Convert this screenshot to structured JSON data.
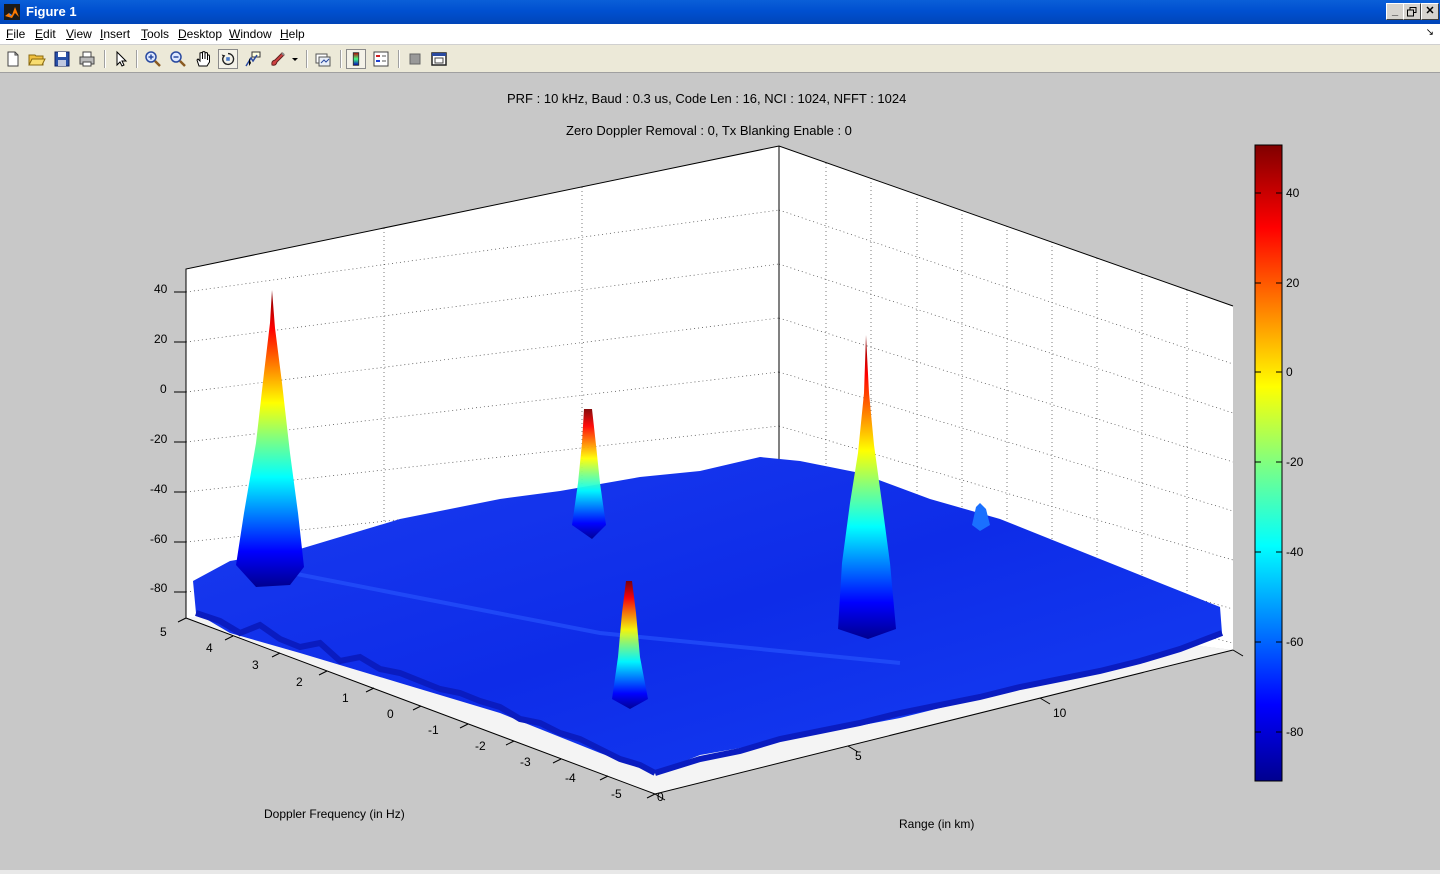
{
  "window": {
    "title": "Figure 1",
    "controls": [
      "minimize-icon",
      "restore-icon",
      "close-icon"
    ]
  },
  "menu": {
    "items": [
      "File",
      "Edit",
      "View",
      "Insert",
      "Tools",
      "Desktop",
      "Window",
      "Help"
    ],
    "underline_first_letter": true
  },
  "toolbar": {
    "buttons": [
      "new-figure-icon",
      "open-file-icon",
      "save-icon",
      "print-icon",
      "edit-plot-arrow-icon",
      "zoom-in-icon",
      "zoom-out-icon",
      "pan-hand-icon",
      "rotate-3d-icon",
      "data-cursor-icon",
      "brush-icon",
      "brush-dropdown-icon",
      "link-plot-icon",
      "insert-colorbar-icon",
      "insert-legend-icon",
      "hide-plot-tools-icon",
      "show-plot-tools-icon"
    ]
  },
  "plot": {
    "title_line1": "PRF : 10 kHz, Baud : 0.3 us, Code Len : 16, NCI : 1024, NFFT : 1024",
    "title_line2": "Zero Doppler Removal : 0, Tx Blanking Enable : 0",
    "xlabel": "Doppler Frequency (in Hz)",
    "ylabel": "Range (in km)",
    "colorbar_ticks": [
      "40",
      "20",
      "0",
      "-20",
      "-40",
      "-60",
      "-80"
    ],
    "colors": {
      "axis_bg": "#ffffff",
      "figure_bg": "#c8c8c8",
      "noise_floor": "#1030f0"
    }
  },
  "chart_data": {
    "type": "surface",
    "colormap": "jet",
    "x_axis": {
      "label": "Doppler Frequency (in Hz)",
      "range": [
        -5,
        5
      ],
      "ticks": [
        5,
        4,
        3,
        2,
        1,
        0,
        -1,
        -2,
        -3,
        -4,
        -5
      ]
    },
    "y_axis": {
      "label": "Range (in km)",
      "range": [
        0,
        15
      ],
      "ticks": [
        0,
        5,
        10
      ]
    },
    "z_axis": {
      "range": [
        -90,
        50
      ],
      "ticks": [
        40,
        20,
        0,
        -20,
        -40,
        -60,
        -80
      ]
    },
    "colorbar": {
      "range": [
        -90,
        50
      ],
      "ticks": [
        40,
        20,
        0,
        -20,
        -40,
        -60,
        -80
      ]
    },
    "noise_floor_db": -80,
    "peaks": [
      {
        "doppler_hz": 4.5,
        "range_km": 0.5,
        "value_db": 40
      },
      {
        "doppler_hz": 4.3,
        "range_km": 9,
        "value_db": -15
      },
      {
        "doppler_hz": -4.3,
        "range_km": 7.5,
        "value_db": 22
      },
      {
        "doppler_hz": -4.0,
        "range_km": 3,
        "value_db": -30
      }
    ],
    "grid": true
  }
}
